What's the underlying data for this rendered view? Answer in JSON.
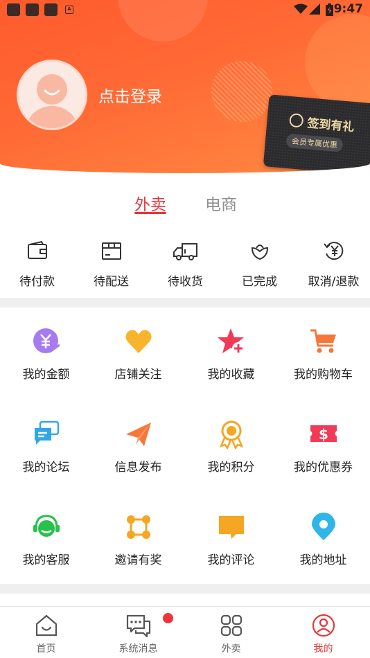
{
  "status_bar": {
    "time": "9:47",
    "badge": "A"
  },
  "header": {
    "login_text": "点击登录",
    "sign_card": {
      "title": "签到有礼",
      "subtitle": "会员专属优惠"
    }
  },
  "tabs": [
    {
      "label": "外卖",
      "active": true
    },
    {
      "label": "电商",
      "active": false
    }
  ],
  "orders": [
    {
      "label": "待付款",
      "icon": "wallet-icon"
    },
    {
      "label": "待配送",
      "icon": "package-icon"
    },
    {
      "label": "待收货",
      "icon": "delivery-truck-icon"
    },
    {
      "label": "已完成",
      "icon": "lotus-icon"
    },
    {
      "label": "取消/退款",
      "icon": "refund-yen-icon"
    }
  ],
  "grid": [
    {
      "label": "我的金额",
      "icon": "yen-coin-icon",
      "color": "#a77bf0"
    },
    {
      "label": "店铺关注",
      "icon": "heart-icon",
      "color": "#f9b42d"
    },
    {
      "label": "我的收藏",
      "icon": "star-plus-icon",
      "color": "#f23a57"
    },
    {
      "label": "我的购物车",
      "icon": "shopping-cart-icon",
      "color": "#f5773a"
    },
    {
      "label": "我的论坛",
      "icon": "chat-bubbles-icon",
      "color": "#2fa7e9"
    },
    {
      "label": "信息发布",
      "icon": "paper-plane-icon",
      "color": "#f5773a"
    },
    {
      "label": "我的积分",
      "icon": "medal-icon",
      "color": "#f5a623"
    },
    {
      "label": "我的优惠券",
      "icon": "coupon-icon",
      "color": "#f23a57"
    },
    {
      "label": "我的客服",
      "icon": "headset-icon",
      "color": "#27c24c"
    },
    {
      "label": "邀请有奖",
      "icon": "network-icon",
      "color": "#f5a623"
    },
    {
      "label": "我的评论",
      "icon": "comment-icon",
      "color": "#f5a623"
    },
    {
      "label": "我的地址",
      "icon": "location-pin-icon",
      "color": "#2fb6e9"
    }
  ],
  "bottom_nav": [
    {
      "label": "首页",
      "icon": "home-icon",
      "active": false
    },
    {
      "label": "系统消息",
      "icon": "message-icon",
      "active": false
    },
    {
      "label": "外卖",
      "icon": "apps-icon",
      "active": false
    },
    {
      "label": "我的",
      "icon": "profile-icon",
      "active": true
    }
  ],
  "colors": {
    "accent": "#e8363a",
    "header_start": "#ff5a2c",
    "header_end": "#ff8a42"
  }
}
